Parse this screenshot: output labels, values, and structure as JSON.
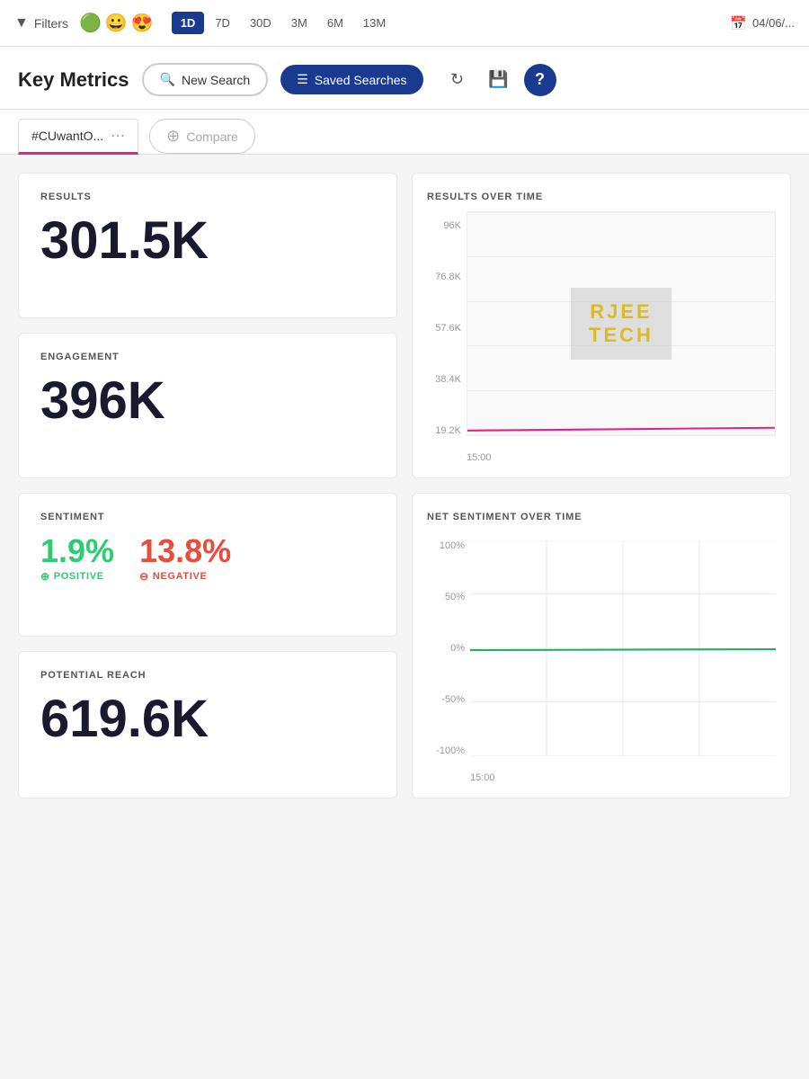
{
  "topbar": {
    "filters_label": "Filters",
    "emojis": [
      "🟢",
      "😀",
      "😍"
    ],
    "time_buttons": [
      {
        "label": "1D",
        "active": true
      },
      {
        "label": "7D",
        "active": false
      },
      {
        "label": "30D",
        "active": false
      },
      {
        "label": "3M",
        "active": false
      },
      {
        "label": "6M",
        "active": false
      },
      {
        "label": "13M",
        "active": false
      }
    ],
    "date": "04/06/..."
  },
  "header": {
    "title": "Key Metrics",
    "new_search_label": "New Search",
    "saved_searches_label": "Saved Searches",
    "refresh_icon": "↻",
    "save_icon": "💾",
    "help_icon": "?"
  },
  "search_tab": {
    "tag_label": "#CUwantO...",
    "compare_label": "Compare"
  },
  "metrics": {
    "results": {
      "label": "RESULTS",
      "value": "301.5K"
    },
    "engagement": {
      "label": "ENGAGEMENT",
      "value": "396K"
    },
    "sentiment": {
      "label": "SENTIMENT",
      "positive_pct": "1.9%",
      "positive_label": "POSITIVE",
      "negative_pct": "13.8%",
      "negative_label": "NEGATIVE"
    },
    "reach": {
      "label": "POTENTIAL REACH",
      "value": "619.6K"
    }
  },
  "charts": {
    "rot": {
      "title": "RESULTS OVER TIME",
      "y_labels": [
        "96K",
        "76.8K",
        "57.6K",
        "38.4K",
        "19.2K"
      ],
      "x_label": "15:00",
      "watermark_line1": "RJEE",
      "watermark_line2": "TECH"
    },
    "nso": {
      "title": "NET SENTIMENT OVER TIME",
      "y_labels": [
        "100%",
        "50%",
        "0%",
        "-50%",
        "-100%"
      ],
      "x_label": "15:00"
    }
  }
}
